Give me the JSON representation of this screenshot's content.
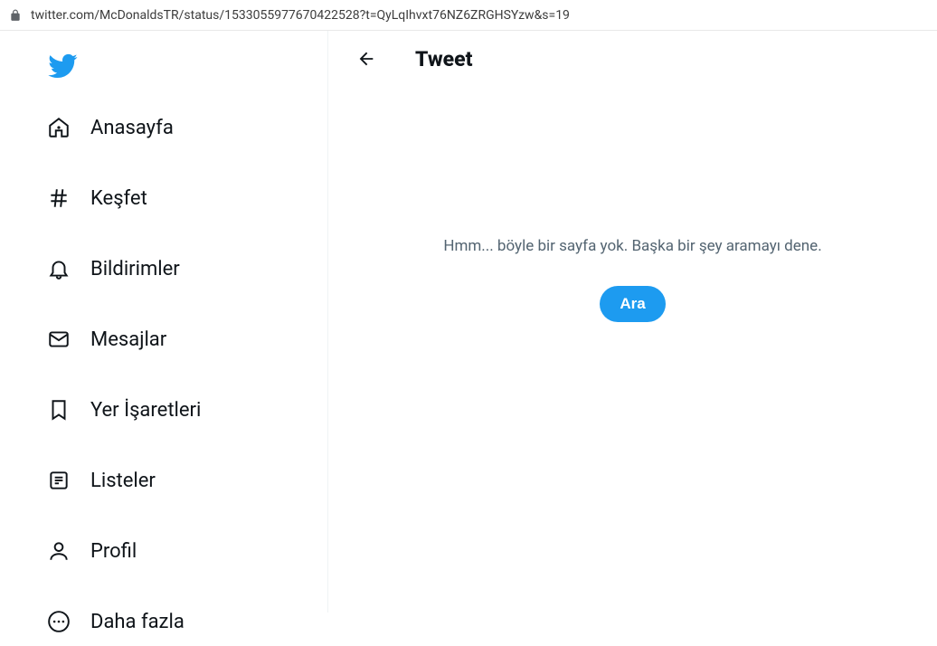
{
  "url": "twitter.com/McDonaldsTR/status/1533055977670422528?t=QyLqIhvxt76NZ6ZRGHSYzw&s=19",
  "sidebar": {
    "items": [
      {
        "label": "Anasayfa"
      },
      {
        "label": "Keşfet"
      },
      {
        "label": "Bildirimler"
      },
      {
        "label": "Mesajlar"
      },
      {
        "label": "Yer İşaretleri"
      },
      {
        "label": "Listeler"
      },
      {
        "label": "Profil"
      },
      {
        "label": "Daha fazla"
      }
    ]
  },
  "header": {
    "title": "Tweet"
  },
  "content": {
    "message": "Hmm... böyle bir sayfa yok. Başka bir şey aramayı dene.",
    "search_label": "Ara"
  }
}
